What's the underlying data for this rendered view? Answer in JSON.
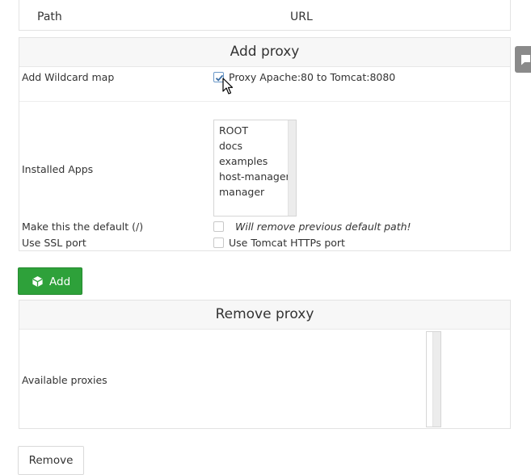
{
  "routes_table": {
    "columns": [
      "Path",
      "URL"
    ]
  },
  "add_proxy": {
    "title": "Add proxy",
    "wildcard": {
      "label": "Add Wildcard map",
      "checkbox_label": "Proxy Apache:80 to Tomcat:8080",
      "checked": true
    },
    "installed_apps": {
      "label": "Installed Apps",
      "options": [
        "ROOT",
        "docs",
        "examples",
        "host-manager",
        "manager"
      ]
    },
    "default": {
      "label": "Make this the default (/)",
      "note": "Will remove previous default path!",
      "checked": false
    },
    "ssl": {
      "label": "Use SSL port",
      "checkbox_label": "Use Tomcat HTTPs port",
      "checked": false
    },
    "add_button": "Add"
  },
  "remove_proxy": {
    "title": "Remove proxy",
    "available_label": "Available proxies",
    "remove_button": "Remove"
  },
  "colors": {
    "add_button": "#2ea13a",
    "checkbox_check": "#3a6ea5",
    "panel_header": "#f7f7f7"
  },
  "icons": {
    "add_button_icon": "cube-icon",
    "side_tab_icon": "chat-bubble-icon",
    "cursor": "mouse-pointer-icon"
  }
}
